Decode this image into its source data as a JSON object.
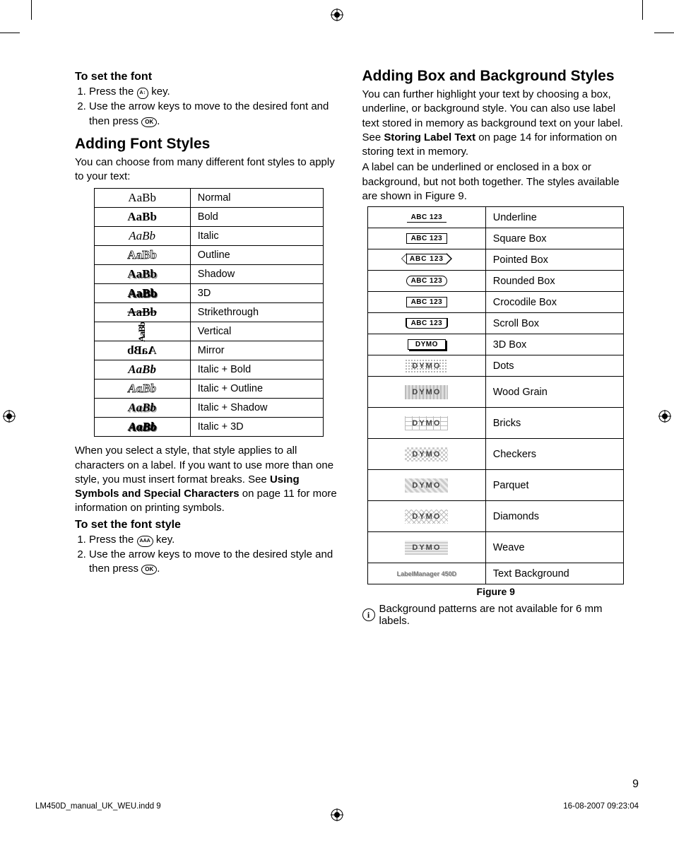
{
  "left": {
    "h_setfont": "To set the font",
    "setfont_steps": [
      "Press the ",
      "Use the arrow keys to move to the desired font and then press "
    ],
    "font_key_label": "A↕",
    "ok_key_label": "OK",
    "h_addfont": "Adding Font Styles",
    "addfont_intro": "You can choose from many different font styles to apply to your text:",
    "font_styles": [
      {
        "sample": "AaBb",
        "label": "Normal"
      },
      {
        "sample": "AaBb",
        "label": "Bold"
      },
      {
        "sample": "AaBb",
        "label": "Italic"
      },
      {
        "sample": "AaBb",
        "label": "Outline"
      },
      {
        "sample": "AaBb",
        "label": "Shadow"
      },
      {
        "sample": "AaBb",
        "label": "3D"
      },
      {
        "sample": "AaBb",
        "label": "Strikethrough"
      },
      {
        "sample": "AaBb",
        "label": "Vertical"
      },
      {
        "sample": "AaBb",
        "label": "Mirror"
      },
      {
        "sample": "AaBb",
        "label": "Italic + Bold"
      },
      {
        "sample": "AaBb",
        "label": "Italic + Outline"
      },
      {
        "sample": "AaBb",
        "label": "Italic + Shadow"
      },
      {
        "sample": "AaBb",
        "label": "Italic + 3D"
      }
    ],
    "after_table_p1": "When you select a style, that style applies to all characters on a label. If you want to use more than one style, you must insert format breaks. See ",
    "after_table_bold": "Using Symbols and Special Characters",
    "after_table_p2": " on page 11 for more information on printing symbols.",
    "h_setstyle": "To set the font style",
    "style_key_label": "AAA",
    "setstyle_steps": [
      "Press the ",
      "Use the arrow keys to move to the desired style and then press "
    ]
  },
  "right": {
    "h_box": "Adding Box and Background Styles",
    "box_p1a": "You can further highlight your text by choosing a box, underline, or background style. You can also use label text stored in memory as background text on your label. See ",
    "box_p1b": "Storing Label Text",
    "box_p1c": " on page 14 for information on storing text in memory.",
    "box_p2": "A label can be underlined or enclosed in a box or background, but not both together. The styles available are shown in Figure 9.",
    "box_styles": [
      {
        "sample": "ABC 123",
        "label": "Underline"
      },
      {
        "sample": "ABC 123",
        "label": "Square Box"
      },
      {
        "sample": "ABC 123",
        "label": "Pointed Box"
      },
      {
        "sample": "ABC 123",
        "label": "Rounded Box"
      },
      {
        "sample": "ABC 123",
        "label": "Crocodile Box"
      },
      {
        "sample": "ABC 123",
        "label": "Scroll Box"
      },
      {
        "sample": "DYMO",
        "label": "3D Box"
      },
      {
        "sample": "DYMO",
        "label": "Dots"
      },
      {
        "sample": "DYMO",
        "label": "Wood Grain"
      },
      {
        "sample": "DYMO",
        "label": "Bricks"
      },
      {
        "sample": "DYMO",
        "label": "Checkers"
      },
      {
        "sample": "DYMO",
        "label": "Parquet"
      },
      {
        "sample": "DYMO",
        "label": "Diamonds"
      },
      {
        "sample": "DYMO",
        "label": "Weave"
      },
      {
        "sample": "LabelManager 450D",
        "label": "Text Background"
      }
    ],
    "figure_caption": "Figure 9",
    "info_note": "Background patterns are not available for 6 mm labels."
  },
  "page_number": "9",
  "footer_left": "LM450D_manual_UK_WEU.indd   9",
  "footer_right": "16-08-2007   09:23:04"
}
